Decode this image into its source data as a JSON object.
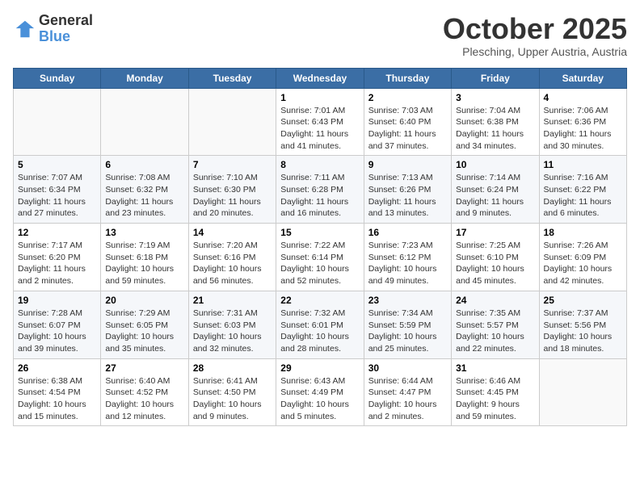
{
  "header": {
    "logo_line1": "General",
    "logo_line2": "Blue",
    "month": "October 2025",
    "location": "Plesching, Upper Austria, Austria"
  },
  "days_of_week": [
    "Sunday",
    "Monday",
    "Tuesday",
    "Wednesday",
    "Thursday",
    "Friday",
    "Saturday"
  ],
  "weeks": [
    [
      {
        "day": "",
        "detail": ""
      },
      {
        "day": "",
        "detail": ""
      },
      {
        "day": "",
        "detail": ""
      },
      {
        "day": "1",
        "detail": "Sunrise: 7:01 AM\nSunset: 6:43 PM\nDaylight: 11 hours\nand 41 minutes."
      },
      {
        "day": "2",
        "detail": "Sunrise: 7:03 AM\nSunset: 6:40 PM\nDaylight: 11 hours\nand 37 minutes."
      },
      {
        "day": "3",
        "detail": "Sunrise: 7:04 AM\nSunset: 6:38 PM\nDaylight: 11 hours\nand 34 minutes."
      },
      {
        "day": "4",
        "detail": "Sunrise: 7:06 AM\nSunset: 6:36 PM\nDaylight: 11 hours\nand 30 minutes."
      }
    ],
    [
      {
        "day": "5",
        "detail": "Sunrise: 7:07 AM\nSunset: 6:34 PM\nDaylight: 11 hours\nand 27 minutes."
      },
      {
        "day": "6",
        "detail": "Sunrise: 7:08 AM\nSunset: 6:32 PM\nDaylight: 11 hours\nand 23 minutes."
      },
      {
        "day": "7",
        "detail": "Sunrise: 7:10 AM\nSunset: 6:30 PM\nDaylight: 11 hours\nand 20 minutes."
      },
      {
        "day": "8",
        "detail": "Sunrise: 7:11 AM\nSunset: 6:28 PM\nDaylight: 11 hours\nand 16 minutes."
      },
      {
        "day": "9",
        "detail": "Sunrise: 7:13 AM\nSunset: 6:26 PM\nDaylight: 11 hours\nand 13 minutes."
      },
      {
        "day": "10",
        "detail": "Sunrise: 7:14 AM\nSunset: 6:24 PM\nDaylight: 11 hours\nand 9 minutes."
      },
      {
        "day": "11",
        "detail": "Sunrise: 7:16 AM\nSunset: 6:22 PM\nDaylight: 11 hours\nand 6 minutes."
      }
    ],
    [
      {
        "day": "12",
        "detail": "Sunrise: 7:17 AM\nSunset: 6:20 PM\nDaylight: 11 hours\nand 2 minutes."
      },
      {
        "day": "13",
        "detail": "Sunrise: 7:19 AM\nSunset: 6:18 PM\nDaylight: 10 hours\nand 59 minutes."
      },
      {
        "day": "14",
        "detail": "Sunrise: 7:20 AM\nSunset: 6:16 PM\nDaylight: 10 hours\nand 56 minutes."
      },
      {
        "day": "15",
        "detail": "Sunrise: 7:22 AM\nSunset: 6:14 PM\nDaylight: 10 hours\nand 52 minutes."
      },
      {
        "day": "16",
        "detail": "Sunrise: 7:23 AM\nSunset: 6:12 PM\nDaylight: 10 hours\nand 49 minutes."
      },
      {
        "day": "17",
        "detail": "Sunrise: 7:25 AM\nSunset: 6:10 PM\nDaylight: 10 hours\nand 45 minutes."
      },
      {
        "day": "18",
        "detail": "Sunrise: 7:26 AM\nSunset: 6:09 PM\nDaylight: 10 hours\nand 42 minutes."
      }
    ],
    [
      {
        "day": "19",
        "detail": "Sunrise: 7:28 AM\nSunset: 6:07 PM\nDaylight: 10 hours\nand 39 minutes."
      },
      {
        "day": "20",
        "detail": "Sunrise: 7:29 AM\nSunset: 6:05 PM\nDaylight: 10 hours\nand 35 minutes."
      },
      {
        "day": "21",
        "detail": "Sunrise: 7:31 AM\nSunset: 6:03 PM\nDaylight: 10 hours\nand 32 minutes."
      },
      {
        "day": "22",
        "detail": "Sunrise: 7:32 AM\nSunset: 6:01 PM\nDaylight: 10 hours\nand 28 minutes."
      },
      {
        "day": "23",
        "detail": "Sunrise: 7:34 AM\nSunset: 5:59 PM\nDaylight: 10 hours\nand 25 minutes."
      },
      {
        "day": "24",
        "detail": "Sunrise: 7:35 AM\nSunset: 5:57 PM\nDaylight: 10 hours\nand 22 minutes."
      },
      {
        "day": "25",
        "detail": "Sunrise: 7:37 AM\nSunset: 5:56 PM\nDaylight: 10 hours\nand 18 minutes."
      }
    ],
    [
      {
        "day": "26",
        "detail": "Sunrise: 6:38 AM\nSunset: 4:54 PM\nDaylight: 10 hours\nand 15 minutes."
      },
      {
        "day": "27",
        "detail": "Sunrise: 6:40 AM\nSunset: 4:52 PM\nDaylight: 10 hours\nand 12 minutes."
      },
      {
        "day": "28",
        "detail": "Sunrise: 6:41 AM\nSunset: 4:50 PM\nDaylight: 10 hours\nand 9 minutes."
      },
      {
        "day": "29",
        "detail": "Sunrise: 6:43 AM\nSunset: 4:49 PM\nDaylight: 10 hours\nand 5 minutes."
      },
      {
        "day": "30",
        "detail": "Sunrise: 6:44 AM\nSunset: 4:47 PM\nDaylight: 10 hours\nand 2 minutes."
      },
      {
        "day": "31",
        "detail": "Sunrise: 6:46 AM\nSunset: 4:45 PM\nDaylight: 9 hours\nand 59 minutes."
      },
      {
        "day": "",
        "detail": ""
      }
    ]
  ]
}
